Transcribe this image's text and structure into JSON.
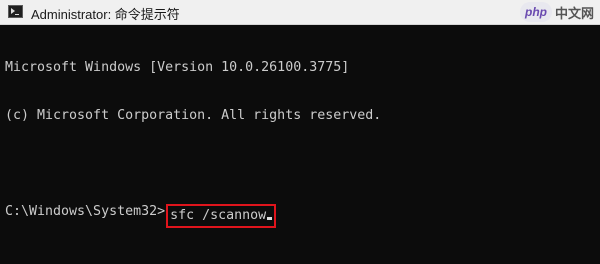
{
  "window": {
    "title": "Administrator: 命令提示符",
    "icon": "cmd-icon"
  },
  "watermark": {
    "logo": "php",
    "text": "中文网"
  },
  "console": {
    "lines": [
      "Microsoft Windows [Version 10.0.26100.3775]",
      "(c) Microsoft Corporation. All rights reserved."
    ],
    "prompt": "C:\\Windows\\System32>",
    "command": "sfc /scannow"
  },
  "colors": {
    "background": "#0c0c0c",
    "text": "#cccccc",
    "highlight": "#e0141c"
  }
}
